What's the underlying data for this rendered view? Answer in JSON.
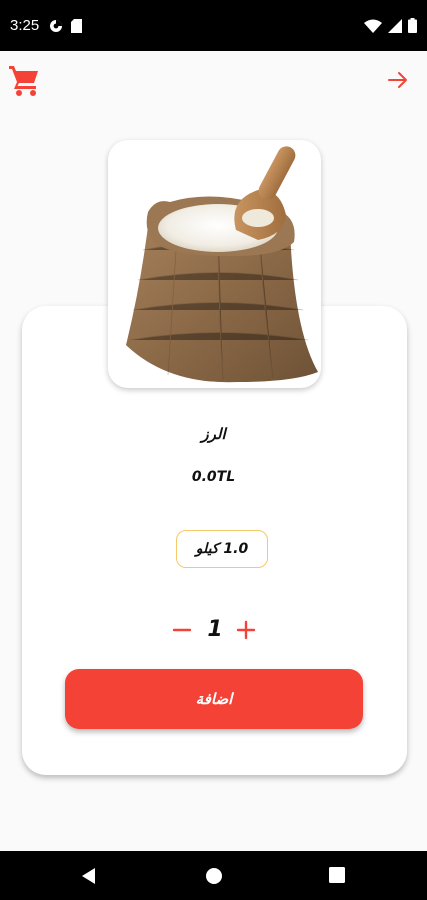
{
  "status_bar": {
    "time": "3:25",
    "icons": [
      "data-saver-icon",
      "sim-card-icon",
      "wifi-icon",
      "cellular-signal-icon",
      "battery-icon"
    ]
  },
  "header": {
    "cart_icon": "shopping-cart-icon",
    "forward_icon": "arrow-right-icon",
    "accent_color": "#f44336"
  },
  "product": {
    "image": "rice-sack-image",
    "name": "الرز",
    "price": "0.0TL",
    "weight_option": "1.0 كيلو",
    "quantity": "1"
  },
  "actions": {
    "add_label": "اضافة",
    "button_color": "#f44336",
    "weight_border_color": "#f5c86b"
  },
  "nav_bar": {
    "icons": [
      "back-icon",
      "home-icon",
      "recents-icon"
    ]
  }
}
